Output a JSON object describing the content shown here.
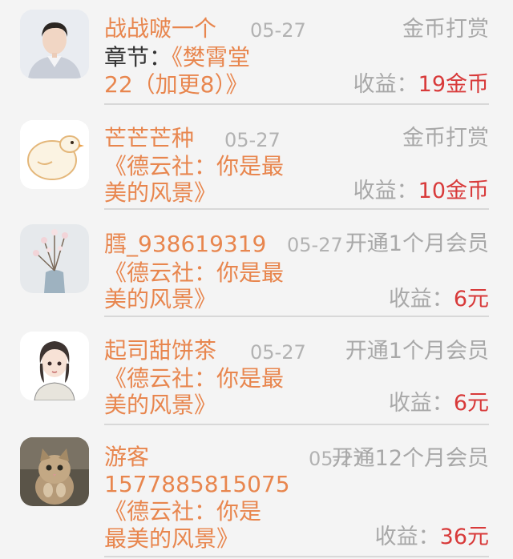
{
  "colors": {
    "name": "#e8864e",
    "muted": "#a8a8a8",
    "amount": "#d83a3a",
    "prefix": "#333333"
  },
  "rows": [
    {
      "name": "战战啵一个",
      "date": "05-27",
      "type": "金币打赏",
      "chapter_prefix": "章节：",
      "line1": "《樊霄堂",
      "line2": "22（加更8）》",
      "earn_label": "收益：",
      "amount": "19金币",
      "avatar": "avatar-man-icon"
    },
    {
      "name": "芒芒芒种",
      "date": "05-27",
      "type": "金币打赏",
      "line1": "《德云社：你是最",
      "line2": "美的风景》",
      "earn_label": "收益：",
      "amount": "10金币",
      "avatar": "avatar-cartoon-bird-icon"
    },
    {
      "name": "膤_938619319",
      "date": "05-27",
      "type": "开通1个月会员",
      "line1": "《德云社：你是最",
      "line2": "美的风景》",
      "earn_label": "收益：",
      "amount": "6元",
      "avatar": "avatar-flower-vase-icon"
    },
    {
      "name": "起司甜饼茶",
      "date": "05-27",
      "type": "开通1个月会员",
      "line1": "《德云社：你是最",
      "line2": "美的风景》",
      "earn_label": "收益：",
      "amount": "6元",
      "avatar": "avatar-anime-girl-icon"
    },
    {
      "name": "游客",
      "name_line2": "1577885815075",
      "date": "05-27",
      "type": "开通12个月会员",
      "line1": "《德云社：你是",
      "line2": "最美的风景》",
      "earn_label": "收益：",
      "amount": "36元",
      "avatar": "avatar-kitten-icon"
    }
  ]
}
